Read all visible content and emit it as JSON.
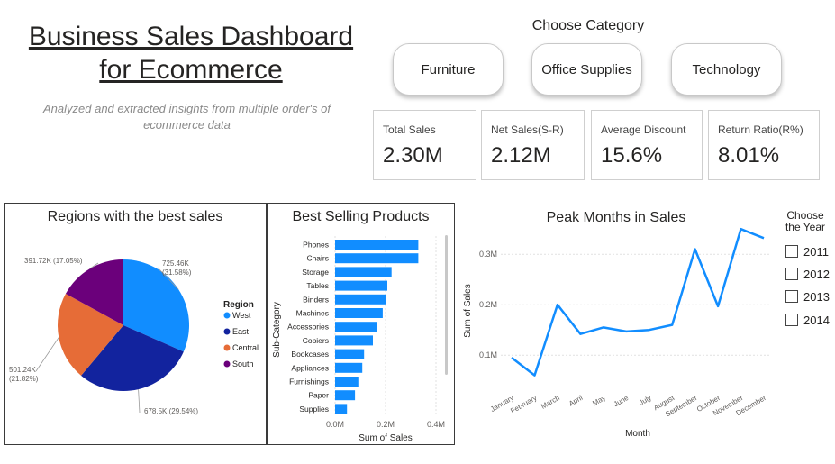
{
  "header": {
    "title_line1": "Business Sales Dashboard ",
    "title_line2": "for Ecommerce",
    "subtitle": "Analyzed and extracted insights from multiple order's of ecommerce data"
  },
  "category": {
    "heading": "Choose Category",
    "options": [
      "Furniture",
      "Office Supplies",
      "Technology"
    ]
  },
  "kpis": [
    {
      "label": "Total Sales",
      "value": "2.30M"
    },
    {
      "label": "Net Sales(S-R)",
      "value": "2.12M"
    },
    {
      "label": "Average Discount",
      "value": "15.6%"
    },
    {
      "label": "Return Ratio(R%)",
      "value": "8.01%"
    }
  ],
  "year_filter": {
    "heading_line1": "Choose",
    "heading_line2": "the Year",
    "years": [
      "2011",
      "2012",
      "2013",
      "2014"
    ]
  },
  "colors": {
    "west": "#118DFF",
    "east": "#12239E",
    "central": "#E66C37",
    "south": "#6B007B",
    "bar": "#118DFF",
    "line": "#118DFF"
  },
  "chart_data": [
    {
      "type": "pie",
      "title": "Regions with the best sales",
      "legend_title": "Region",
      "legend_position": "right",
      "slices": [
        {
          "name": "West",
          "value": 725.46,
          "label_line1": "725.46K",
          "label_line2": "(31.58%)"
        },
        {
          "name": "East",
          "value": 678.5,
          "label_line1": "678.5K (29.54%)",
          "label_line2": ""
        },
        {
          "name": "Central",
          "value": 501.24,
          "label_line1": "501.24K",
          "label_line2": "(21.82%)"
        },
        {
          "name": "South",
          "value": 391.72,
          "label_line1": "391.72K (17.05%)",
          "label_line2": ""
        }
      ]
    },
    {
      "type": "bar",
      "orientation": "horizontal",
      "title": "Best Selling Products",
      "xlabel": "Sum of Sales",
      "ylabel": "Sub-Category",
      "xlim": [
        0,
        0.4
      ],
      "x_ticks": [
        "0.0M",
        "0.2M",
        "0.4M"
      ],
      "categories": [
        "Phones",
        "Chairs",
        "Storage",
        "Tables",
        "Binders",
        "Machines",
        "Accessories",
        "Copiers",
        "Bookcases",
        "Appliances",
        "Furnishings",
        "Paper",
        "Supplies"
      ],
      "values": [
        0.33,
        0.33,
        0.224,
        0.207,
        0.203,
        0.189,
        0.167,
        0.15,
        0.115,
        0.108,
        0.092,
        0.079,
        0.047
      ],
      "grid": true
    },
    {
      "type": "line",
      "title": "Peak Months in Sales",
      "xlabel": "Month",
      "ylabel": "Sum of Sales",
      "ylim": [
        0.02,
        0.37
      ],
      "y_ticks": [
        {
          "value": 0.1,
          "label": "0.1M"
        },
        {
          "value": 0.2,
          "label": "0.2M"
        },
        {
          "value": 0.3,
          "label": "0.3M"
        }
      ],
      "x": [
        "January",
        "February",
        "March",
        "April",
        "May",
        "June",
        "July",
        "August",
        "September",
        "October",
        "November",
        "December"
      ],
      "values": [
        0.095,
        0.06,
        0.2,
        0.142,
        0.155,
        0.147,
        0.15,
        0.16,
        0.31,
        0.197,
        0.35,
        0.332
      ],
      "grid": true
    }
  ]
}
